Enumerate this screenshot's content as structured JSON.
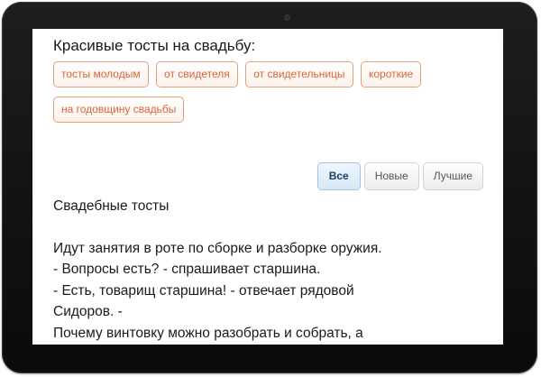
{
  "heading": "Красивые тосты на свадьбу:",
  "tags": [
    "тосты молодым",
    "от свидетеля",
    "от свидетельницы",
    "короткие",
    "на годовщину свадьбы"
  ],
  "sort_buttons": {
    "all": "Все",
    "new": "Новые",
    "best": "Лучшие",
    "active": "all"
  },
  "article": {
    "title": "Свадебные тосты",
    "lines": [
      "Идут занятия в роте по сборке и разборке оружия.",
      "- Вопросы есть? - спрашивает старшина.",
      "- Есть, товарищ старшина! - отвечает рядовой",
      "Сидоров. -",
      "Почему винтовку можно разобрать и собрать, а"
    ]
  },
  "colors": {
    "tag_border": "#e4a07a",
    "tag_text": "#d4663a",
    "active_button_border": "#9ec3e6",
    "bezel": "#141414"
  }
}
